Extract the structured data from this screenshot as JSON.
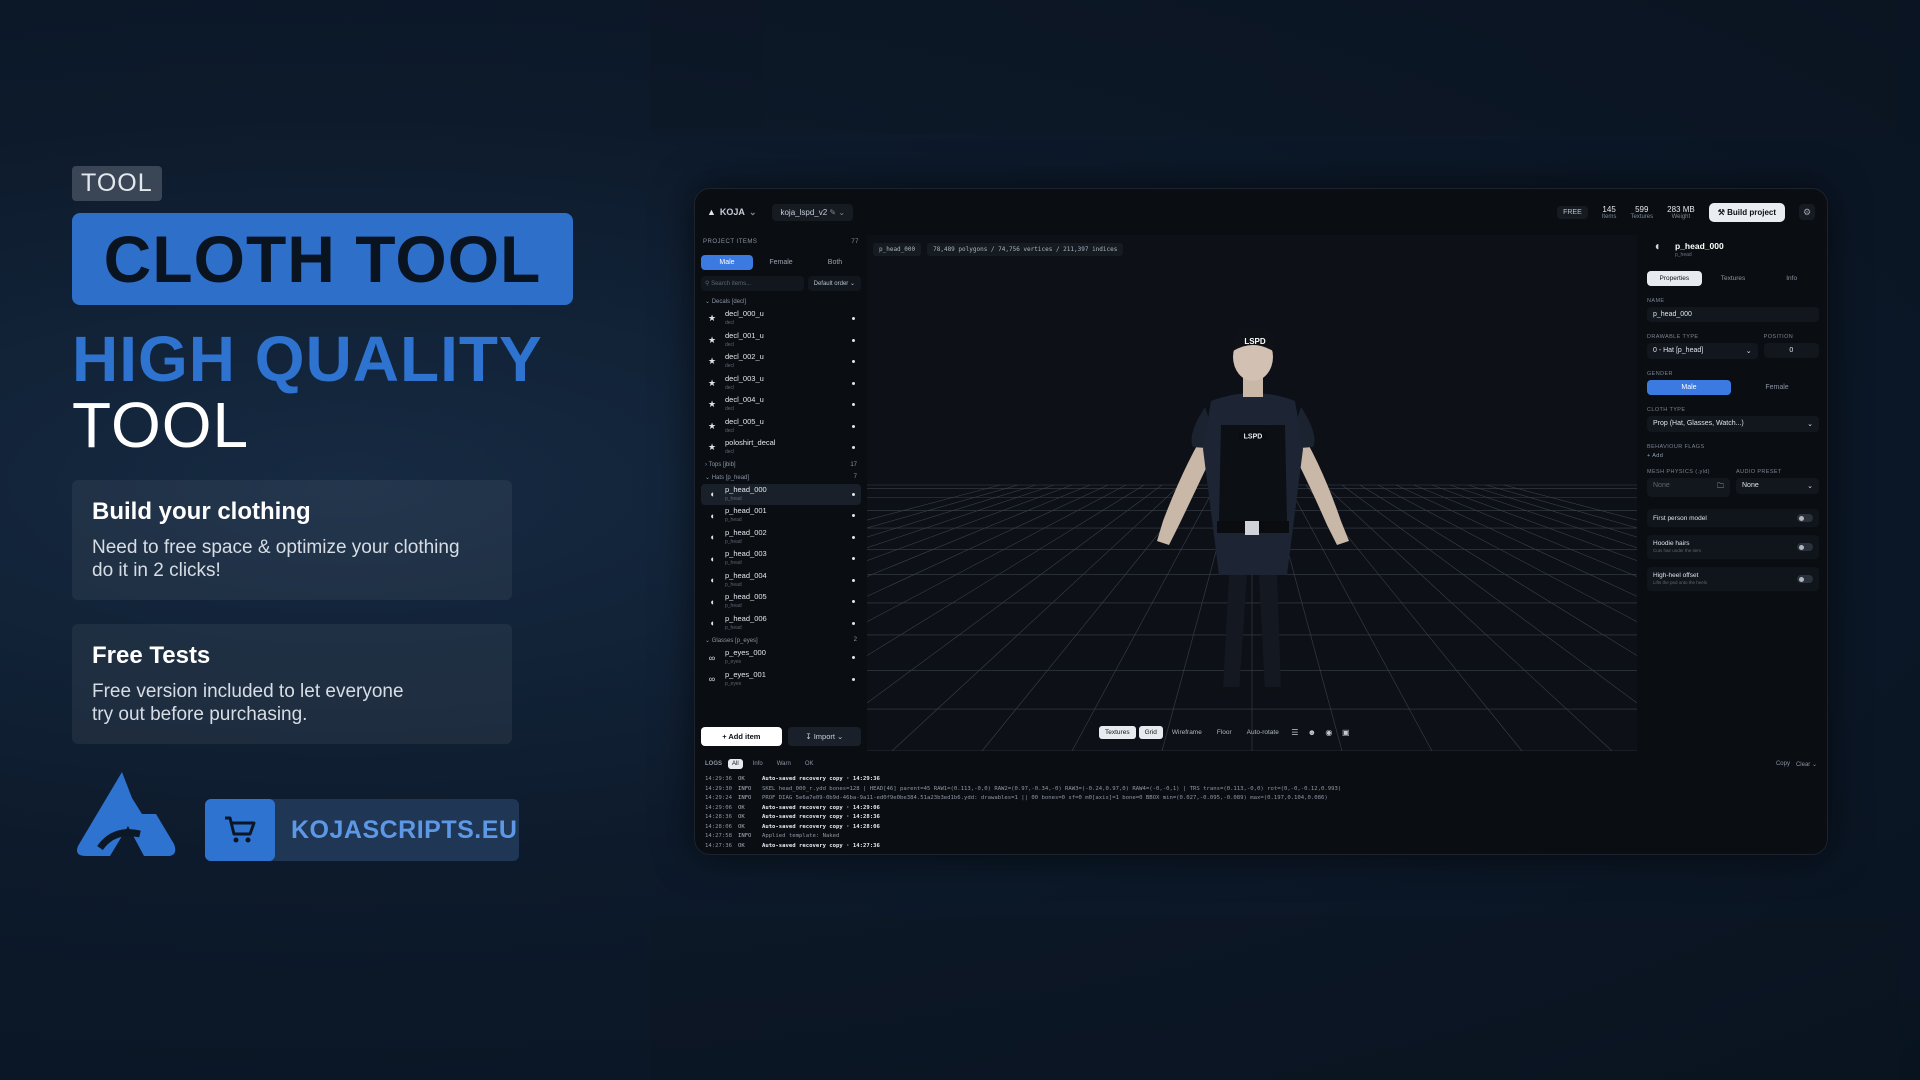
{
  "hero": {
    "tag": "TOOL",
    "title": "CLOTH TOOL",
    "headline_1": "HIGH QUALITY",
    "headline_2": "TOOL",
    "card1_title": "Build your clothing",
    "card1_text": "Need to free space & optimize your clothing\ndo it in 2 clicks!",
    "card2_title": "Free Tests",
    "card2_text": "Free version included to let everyone\ntry out before purchasing.",
    "shop_label": "KOJASCRIPTS.EU"
  },
  "app": {
    "brand": "KOJA",
    "project": "koja_lspd_v2",
    "free_badge": "FREE",
    "stats": [
      {
        "value": "145",
        "label": "Items"
      },
      {
        "value": "599",
        "label": "Textures"
      },
      {
        "value": "283 MB",
        "label": "Weight"
      }
    ],
    "build_label": "Build project"
  },
  "left_panel": {
    "title": "PROJECT ITEMS",
    "count": "77",
    "tabs": [
      "Male",
      "Female",
      "Both"
    ],
    "search_placeholder": "Search items...",
    "order": "Default order",
    "group_decals": "Decals [decl]",
    "group_tops": "Tops [jbib]",
    "group_tops_count": "17",
    "group_hats": "Hats [p_head]",
    "group_hats_count": "7",
    "group_glasses": "Glasses [p_eyes]",
    "group_glasses_count": "2",
    "decals": [
      {
        "name": "decl_000_u",
        "sub": "decl"
      },
      {
        "name": "decl_001_u",
        "sub": "decl"
      },
      {
        "name": "decl_002_u",
        "sub": "decl"
      },
      {
        "name": "decl_003_u",
        "sub": "decl"
      },
      {
        "name": "decl_004_u",
        "sub": "decl"
      },
      {
        "name": "decl_005_u",
        "sub": "decl"
      },
      {
        "name": "poloshirt_decal",
        "sub": "decl"
      }
    ],
    "hats": [
      {
        "name": "p_head_000",
        "sub": "p_head"
      },
      {
        "name": "p_head_001",
        "sub": "p_head"
      },
      {
        "name": "p_head_002",
        "sub": "p_head"
      },
      {
        "name": "p_head_003",
        "sub": "p_head"
      },
      {
        "name": "p_head_004",
        "sub": "p_head"
      },
      {
        "name": "p_head_005",
        "sub": "p_head"
      },
      {
        "name": "p_head_006",
        "sub": "p_head"
      }
    ],
    "glasses": [
      {
        "name": "p_eyes_000",
        "sub": "p_eyes"
      },
      {
        "name": "p_eyes_001",
        "sub": "p_eyes"
      }
    ],
    "add_label": "Add item",
    "import_label": "Import"
  },
  "viewport": {
    "item": "p_head_000",
    "geometry": "78,489 polygons / 74,756 vertices / 211,397 indices",
    "tools": [
      "Textures",
      "Grid",
      "Wireframe",
      "Floor",
      "Auto-rotate"
    ],
    "badge_lspd": "LSPD",
    "badge_chest": "LSPD"
  },
  "right_panel": {
    "item": "p_head_000",
    "item_sub": "p_head",
    "tabs": [
      "Properties",
      "Textures",
      "Info"
    ],
    "name_label": "NAME",
    "name_value": "p_head_000",
    "drawable_label": "DRAWABLE TYPE",
    "drawable_value": "0 - Hat [p_head]",
    "position_label": "POSITION",
    "position_value": "0",
    "gender_label": "GENDER",
    "genders": [
      "Male",
      "Female"
    ],
    "cloth_label": "CLOTH TYPE",
    "cloth_value": "Prop (Hat, Glasses, Watch...)",
    "flags_label": "BEHAVIOUR FLAGS",
    "flags_add": "+ Add",
    "mesh_label": "MESH PHYSICS (.yld)",
    "mesh_value": "None",
    "audio_label": "AUDIO PRESET",
    "audio_value": "None",
    "toggles": [
      {
        "name": "First person model",
        "sub": ""
      },
      {
        "name": "Hoodie hairs",
        "sub": "Cuts hair under the item"
      },
      {
        "name": "High-heel offset",
        "sub": "Lifts the ped onto the heels"
      }
    ]
  },
  "logs": {
    "title": "LOGS",
    "filters": [
      "All",
      "Info",
      "Warn",
      "OK"
    ],
    "copy": "Copy",
    "clear": "Clear",
    "lines": [
      {
        "t": "14:29:36",
        "l": "OK",
        "m": "Auto-saved recovery copy · 14:29:36",
        "b": true
      },
      {
        "t": "14:29:30",
        "l": "INFO",
        "m": "SKEL head_000_r.ydd bones=128 | HEAD[46] parent=45 RAW1=(0.113,-0,0) RAW2=(0.97,-0.34,-0) RAW3=(-0.24,0.97,0) RAW4=(-0,-0,1) | TRS trans=(0.113,-0,0) rot=(0,-0,-0.12,0.993)",
        "b": false
      },
      {
        "t": "14:29:24",
        "l": "INFO",
        "m": "PROF DIAG 5e6a7e09-0b9d-46ba-9a11-ed0f9e0be384.51a23b3ed1b6.ydd: drawables=1 || 00 bones=0 sf=0 m0[axis]=1 bone=0 BBOX min=(0.027,-0.095,-0.089) max=(0.197,0.104,0.086)",
        "b": false
      },
      {
        "t": "14:29:06",
        "l": "OK",
        "m": "Auto-saved recovery copy · 14:29:06",
        "b": true
      },
      {
        "t": "14:28:36",
        "l": "OK",
        "m": "Auto-saved recovery copy · 14:28:36",
        "b": true
      },
      {
        "t": "14:28:06",
        "l": "OK",
        "m": "Auto-saved recovery copy · 14:28:06",
        "b": true
      },
      {
        "t": "14:27:58",
        "l": "INFO",
        "m": "Applied template: Naked",
        "b": false
      },
      {
        "t": "14:27:36",
        "l": "OK",
        "m": "Auto-saved recovery copy · 14:27:36",
        "b": true
      }
    ]
  },
  "colors": {
    "accent": "#2f73d1",
    "panel": "#0a0d12"
  }
}
